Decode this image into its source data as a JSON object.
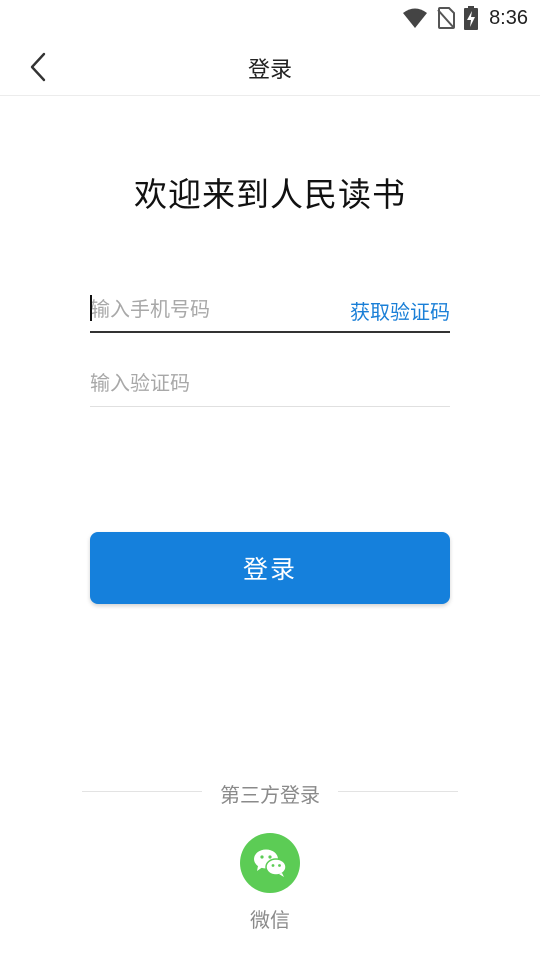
{
  "status_bar": {
    "time": "8:36"
  },
  "header": {
    "title": "登录"
  },
  "welcome_text": "欢迎来到人民读书",
  "form": {
    "phone_placeholder": "输入手机号码",
    "get_code_label": "获取验证码",
    "code_placeholder": "输入验证码"
  },
  "login_button_label": "登录",
  "third_party": {
    "title": "第三方登录",
    "wechat_label": "微信"
  },
  "colors": {
    "primary": "#1580dc",
    "link": "#1a7fd7",
    "wechat": "#5ccc55"
  },
  "icons": [
    "wifi-icon",
    "no-sim-icon",
    "battery-charging-icon",
    "back-arrow-icon",
    "wechat-icon"
  ]
}
